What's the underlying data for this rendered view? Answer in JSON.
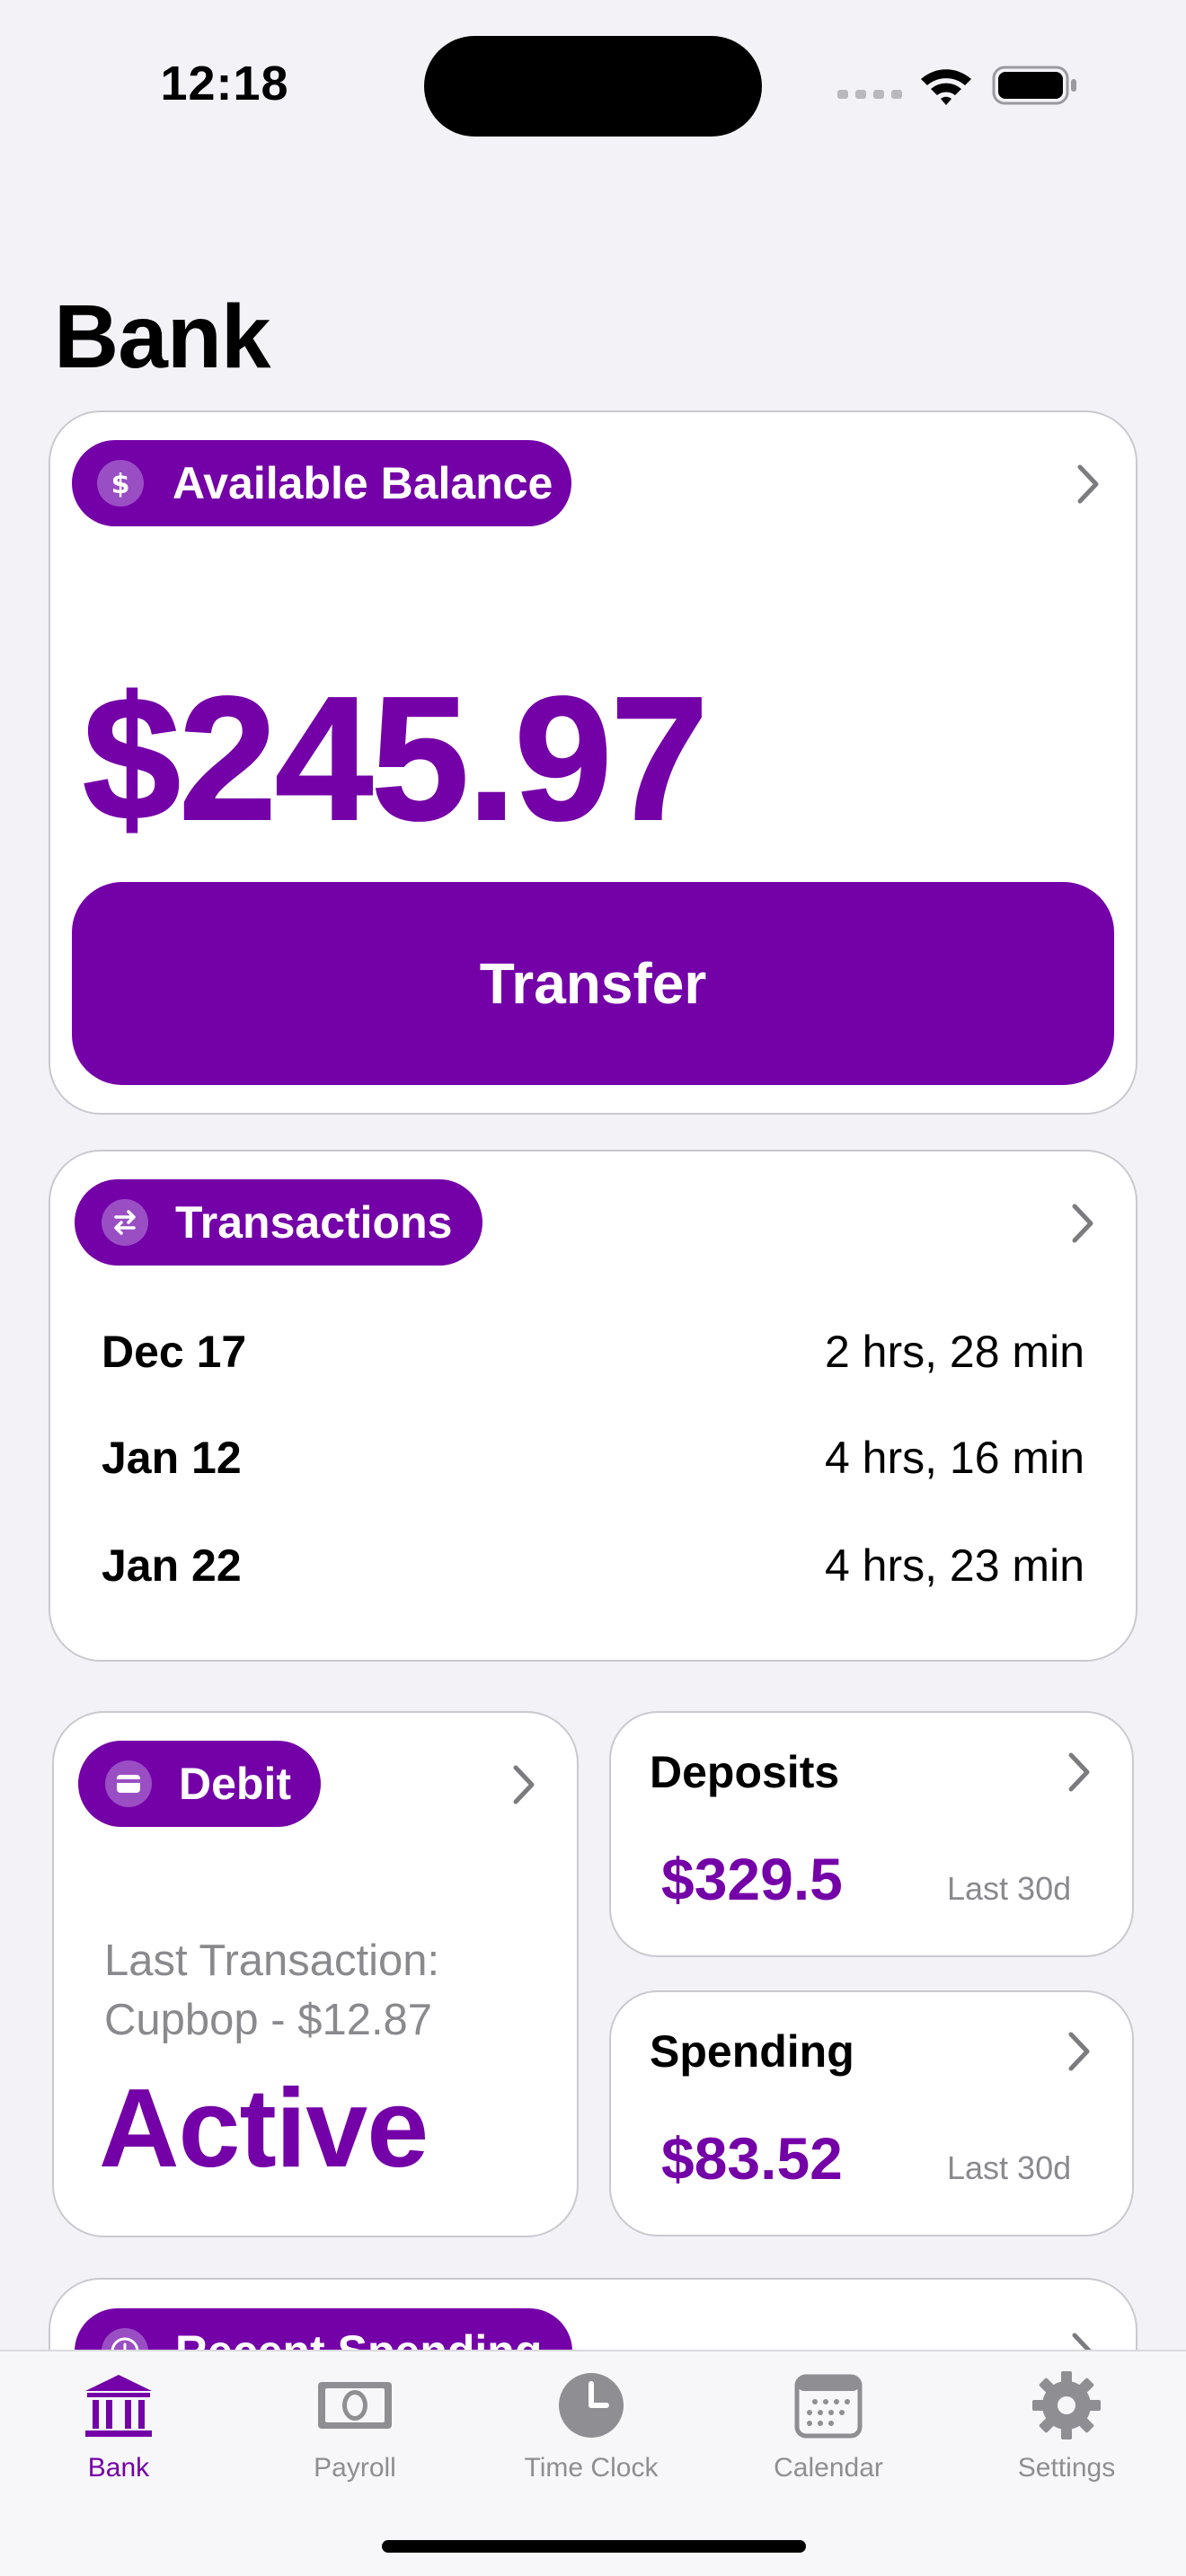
{
  "status_bar": {
    "time": "12:18"
  },
  "page": {
    "title": "Bank"
  },
  "balance_card": {
    "pill_label": "Available Balance",
    "pill_icon": "dollar-icon",
    "amount": "$245.97",
    "transfer_label": "Transfer"
  },
  "transactions_card": {
    "pill_label": "Transactions",
    "pill_icon": "arrows-swap-icon",
    "rows": [
      {
        "date": "Dec 17",
        "duration": "2 hrs, 28 min"
      },
      {
        "date": "Jan 12",
        "duration": "4 hrs, 16 min"
      },
      {
        "date": "Jan 22",
        "duration": "4 hrs, 23 min"
      }
    ]
  },
  "debit_card": {
    "pill_label": "Debit",
    "pill_icon": "credit-card-icon",
    "last_transaction_line1": "Last Transaction:",
    "last_transaction_line2": "Cupbop - $12.87",
    "status": "Active"
  },
  "deposits_card": {
    "title": "Deposits",
    "value": "$329.5",
    "period": "Last 30d"
  },
  "spending_card": {
    "title": "Spending",
    "value": "$83.52",
    "period": "Last 30d"
  },
  "recent_spending_card": {
    "pill_label": "Recent Spending",
    "pill_icon": "clock-icon"
  },
  "tab_bar": {
    "tabs": [
      {
        "label": "Bank",
        "icon": "bank-icon",
        "active": true
      },
      {
        "label": "Payroll",
        "icon": "banknote-icon",
        "active": false
      },
      {
        "label": "Time Clock",
        "icon": "clock-icon",
        "active": false
      },
      {
        "label": "Calendar",
        "icon": "calendar-icon",
        "active": false
      },
      {
        "label": "Settings",
        "icon": "gear-icon",
        "active": false
      }
    ]
  },
  "colors": {
    "accent": "#7400a8",
    "background": "#f2f2f7",
    "card": "#ffffff",
    "secondary_text": "#8a8a8e"
  }
}
